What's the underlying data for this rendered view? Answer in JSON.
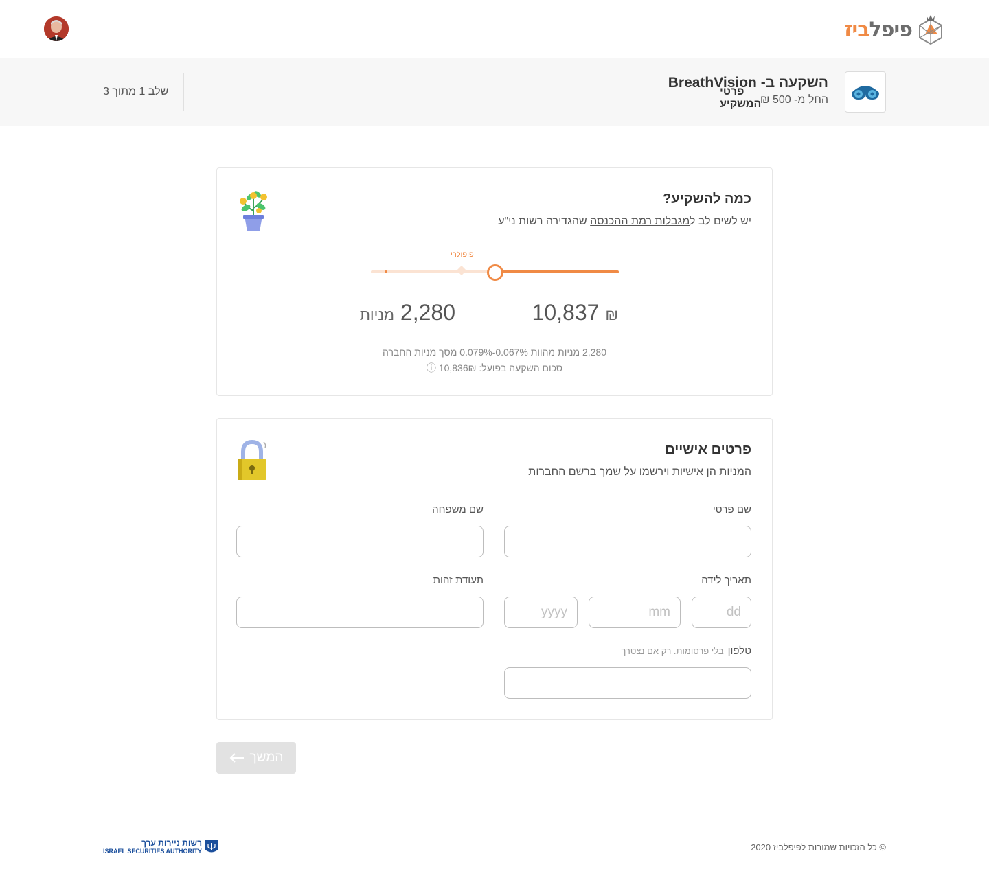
{
  "header": {
    "logo_part1": "פיפל",
    "logo_part2": "ביז"
  },
  "subheader": {
    "title": "השקעה ב- BreathVision",
    "min_investment": "החל מ- 500 ₪",
    "stage": "פרטי המשקיע",
    "step": "שלב 1 מתוך 3"
  },
  "invest_card": {
    "title": "כמה להשקיע?",
    "desc_prefix": "יש לשים לב ל",
    "desc_link": "מגבלות רמת ההכנסה",
    "desc_suffix": " שהגדירה רשות ני\"ע",
    "popular_label": "פופולרי",
    "slider_fraction": 0.5,
    "amount_value": "10,837",
    "amount_unit": "₪",
    "shares_value": "2,280",
    "shares_unit": "מניות",
    "note_line1": "2,280 מניות מהוות 0.067%-0.079% מסך מניות החברה",
    "note_line2": "סכום השקעה בפועל: 10,836₪ ⓘ"
  },
  "personal_card": {
    "title": "פרטים אישיים",
    "desc": "המניות הן אישיות וירשמו על שמך ברשם החברות",
    "first_name_label": "שם פרטי",
    "last_name_label": "שם משפחה",
    "birth_date_label": "תאריך לידה",
    "id_label": "תעודת זהות",
    "phone_label": "טלפון",
    "phone_hint": "בלי פרסומות. רק אם נצטרך",
    "dd_placeholder": "dd",
    "mm_placeholder": "mm",
    "yyyy_placeholder": "yyyy"
  },
  "continue_label": "המשך",
  "footer": {
    "copyright": "© כל הזכויות שמורות לפיפלביז 2020",
    "isa_he": "רשות ניירות ערך",
    "isa_en": "ISRAEL SECURITIES AUTHORITY"
  },
  "colors": {
    "accent": "#f08a45",
    "isa_blue": "#1b4f9c"
  }
}
